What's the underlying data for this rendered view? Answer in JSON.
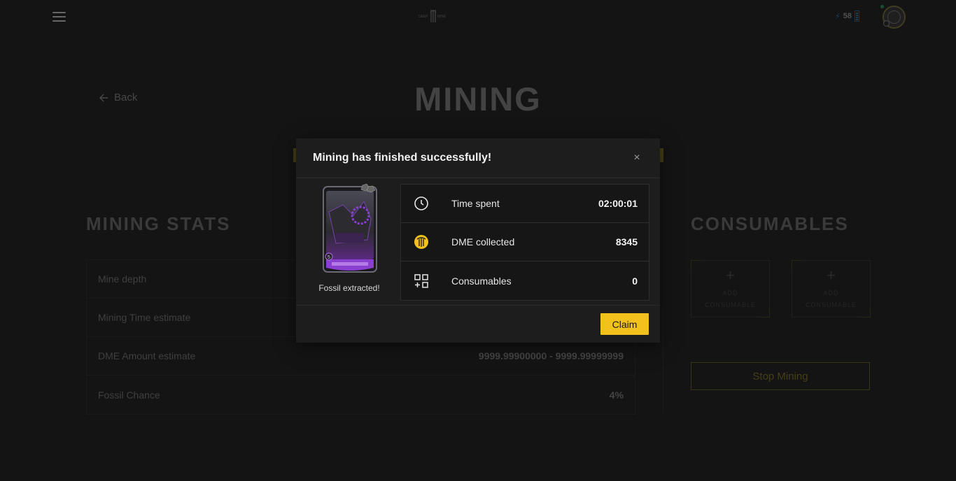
{
  "header": {
    "energy_value": "58",
    "menu_icon": "hamburger-menu-icon",
    "logo_icon": "deep-mine-logo"
  },
  "nav": {
    "back_label": "Back"
  },
  "page_title": "MINING",
  "mining_stats": {
    "title": "MINING STATS",
    "rows": [
      {
        "label": "Mine depth",
        "value": ""
      },
      {
        "label": "Mining Time estimate",
        "value": ""
      },
      {
        "label": "DME Amount estimate",
        "value": "9999.99900000 - 9999.99999999"
      },
      {
        "label": "Fossil Chance",
        "value": "4%"
      }
    ]
  },
  "consumables": {
    "title": "CONSUMABLES",
    "slots": [
      {
        "line1": "ADD",
        "line2": "CONSUMABLE"
      },
      {
        "line1": "ADD",
        "line2": "CONSUMABLE"
      }
    ],
    "stop_button": "Stop Mining"
  },
  "modal": {
    "title": "Mining has finished successfully!",
    "close_label": "×",
    "card_caption": "Fossil extracted!",
    "card_level": "5",
    "rows": [
      {
        "icon": "clock-icon",
        "label": "Time spent",
        "value": "02:00:01"
      },
      {
        "icon": "dme-coin-icon",
        "label": "DME collected",
        "value": "8345"
      },
      {
        "icon": "consumables-grid-icon",
        "label": "Consumables",
        "value": "0"
      }
    ],
    "claim_label": "Claim"
  },
  "colors": {
    "accent": "#f2c11c",
    "modal_bg": "#1d1d1d",
    "page_bg": "#1b1b1b",
    "card_purple": "#8a3fd1"
  }
}
